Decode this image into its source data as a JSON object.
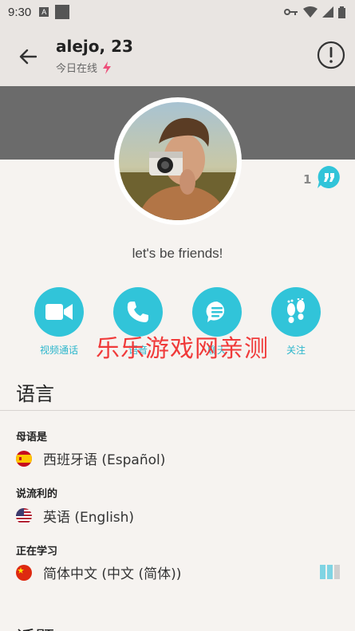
{
  "status_bar": {
    "time": "9:30"
  },
  "header": {
    "title": "alejo, 23",
    "online_status": "今日在线"
  },
  "profile": {
    "references_count": "1",
    "bio": "let's be friends!"
  },
  "actions": [
    {
      "label": "视频通话",
      "icon": "video-icon"
    },
    {
      "label": "语音",
      "icon": "phone-icon"
    },
    {
      "label": "聊天",
      "icon": "chat-icon"
    },
    {
      "label": "关注",
      "icon": "footprints-icon"
    }
  ],
  "watermark": "乐乐游戏网亲测",
  "languages": {
    "section_title": "语言",
    "native_label": "母语是",
    "native": "西班牙语 (Español)",
    "fluent_label": "说流利的",
    "fluent": "英语 (English)",
    "learning_label": "正在学习",
    "learning": "简体中文 (中文 (简体))",
    "learning_level": 0.66
  },
  "next_section_title": "话题",
  "colors": {
    "accent": "#31c4d9",
    "banner": "#6b6b6b",
    "header_bg": "#e9e5e2",
    "page_bg": "#f6f3f0",
    "watermark": "#f03a3a",
    "online_bolt": "#ee4f7a"
  }
}
